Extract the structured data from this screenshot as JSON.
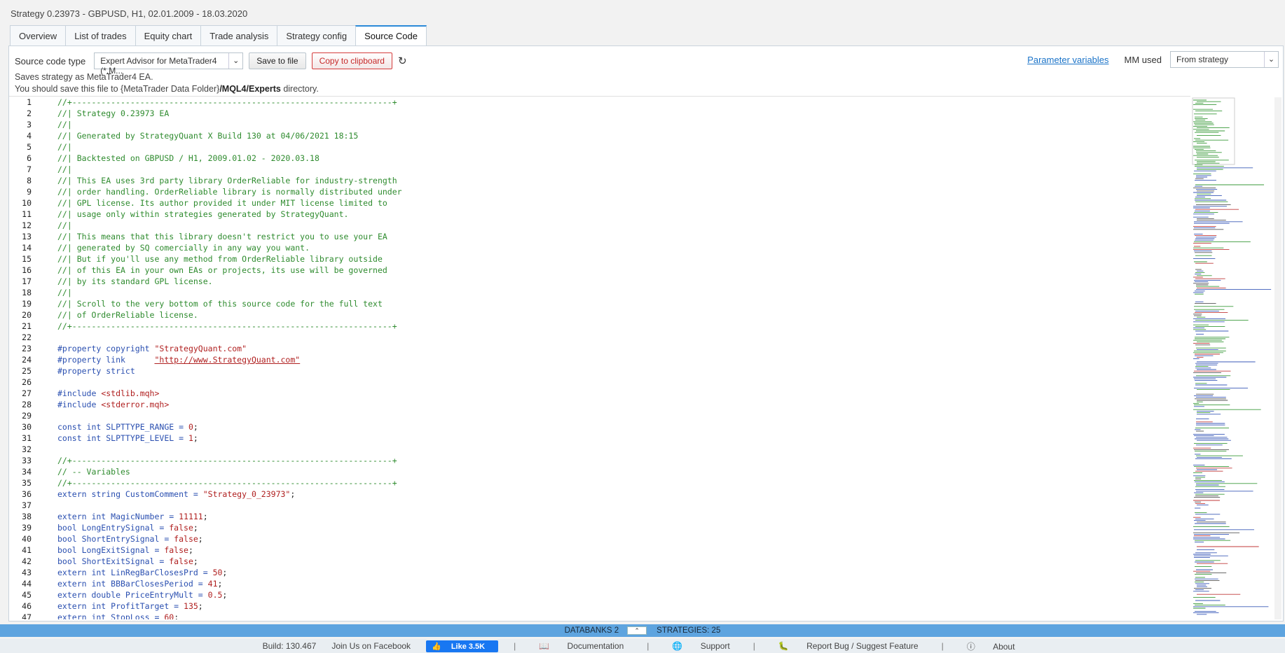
{
  "window_title": "Strategy 0.23973 - GBPUSD, H1, 02.01.2009 - 18.03.2020",
  "tabs": [
    {
      "label": "Overview"
    },
    {
      "label": "List of trades"
    },
    {
      "label": "Equity chart"
    },
    {
      "label": "Trade analysis"
    },
    {
      "label": "Strategy config"
    },
    {
      "label": "Source Code",
      "active": true
    }
  ],
  "toolbar": {
    "source_type_label": "Source code type",
    "source_type_value": "Expert Advisor for MetaTrader4 (*.M...",
    "save_label": "Save to file",
    "copy_label": "Copy to clipboard",
    "param_vars_label": "Parameter variables",
    "mm_used_label": "MM used",
    "mm_used_value": "From strategy"
  },
  "info": {
    "line1": "Saves strategy as MetaTrader4 EA.",
    "line2_pre": "You should save this file to {MetaTrader Data Folder}",
    "line2_bold": "/MQL4/Experts",
    "line2_post": " directory."
  },
  "code_lines": [
    {
      "n": "1",
      "t": "//+------------------------------------------------------------------+",
      "c": "c"
    },
    {
      "n": "2",
      "t": "//| Strategy 0.23973 EA",
      "c": "c"
    },
    {
      "n": "3",
      "t": "//|",
      "c": "c"
    },
    {
      "n": "4",
      "t": "//| Generated by StrategyQuant X Build 130 at 04/06/2021 18:15",
      "c": "c"
    },
    {
      "n": "5",
      "t": "//|",
      "c": "c"
    },
    {
      "n": "6",
      "t": "//| Backtested on GBPUSD / H1, 2009.01.02 - 2020.03.18",
      "c": "c"
    },
    {
      "n": "7",
      "t": "//|",
      "c": "c"
    },
    {
      "n": "8",
      "t": "//| This EA uses 3rd party library OrderReliable for industry-strength",
      "c": "c"
    },
    {
      "n": "9",
      "t": "//| order handling. OrderReliable library is normally distributed under",
      "c": "c"
    },
    {
      "n": "10",
      "t": "//| GPL license. Its author provided it under MIT license limited to",
      "c": "c"
    },
    {
      "n": "11",
      "t": "//| usage only within strategies generated by StrategyQuant.",
      "c": "c"
    },
    {
      "n": "12",
      "t": "//|",
      "c": "c"
    },
    {
      "n": "13",
      "t": "//| This means that this library doesn't restrict you to use your EA",
      "c": "c"
    },
    {
      "n": "14",
      "t": "//| generated by SQ comercially in any way you want.",
      "c": "c"
    },
    {
      "n": "15",
      "t": "//| But if you'll use any method from OrderReliable library outside",
      "c": "c"
    },
    {
      "n": "16",
      "t": "//| of this EA in your own EAs or projects, its use will be governed",
      "c": "c"
    },
    {
      "n": "17",
      "t": "//| by its standard GPL license.",
      "c": "c"
    },
    {
      "n": "18",
      "t": "//|",
      "c": "c"
    },
    {
      "n": "19",
      "t": "//| Scroll to the very bottom of this source code for the full text",
      "c": "c"
    },
    {
      "n": "20",
      "t": "//| of OrderReliable license.",
      "c": "c"
    },
    {
      "n": "21",
      "t": "//+------------------------------------------------------------------+",
      "c": "c"
    },
    {
      "n": "22",
      "t": "",
      "c": "d"
    },
    {
      "n": "23",
      "t": "#property copyright ",
      "c": "k",
      "s": "\"StrategyQuant.com\""
    },
    {
      "n": "24",
      "t": "#property link      ",
      "c": "k",
      "u": "\"http://www.StrategyQuant.com\""
    },
    {
      "n": "25",
      "t": "#property strict",
      "c": "k"
    },
    {
      "n": "26",
      "t": "",
      "c": "d"
    },
    {
      "n": "27",
      "t": "#include ",
      "c": "k",
      "s": "<stdlib.mqh>"
    },
    {
      "n": "28",
      "t": "#include ",
      "c": "k",
      "s": "<stderror.mqh>"
    },
    {
      "n": "29",
      "t": "",
      "c": "d"
    },
    {
      "n": "30",
      "t": "const int SLPTTYPE_RANGE = ",
      "c": "k",
      "s": "0",
      "e": ";"
    },
    {
      "n": "31",
      "t": "const int SLPTTYPE_LEVEL = ",
      "c": "k",
      "s": "1",
      "e": ";"
    },
    {
      "n": "32",
      "t": "",
      "c": "d"
    },
    {
      "n": "33",
      "t": "//+------------------------------------------------------------------+",
      "c": "c"
    },
    {
      "n": "34",
      "t": "// -- Variables",
      "c": "c"
    },
    {
      "n": "35",
      "t": "//+------------------------------------------------------------------+",
      "c": "c"
    },
    {
      "n": "36",
      "t": "extern string CustomComment = ",
      "c": "k",
      "s": "\"Strategy_0_23973\"",
      "e": ";"
    },
    {
      "n": "37",
      "t": "",
      "c": "d"
    },
    {
      "n": "38",
      "t": "extern int MagicNumber = ",
      "c": "k",
      "s": "11111",
      "e": ";"
    },
    {
      "n": "39",
      "t": "bool LongEntrySignal = ",
      "c": "k",
      "s": "false",
      "e": ";"
    },
    {
      "n": "40",
      "t": "bool ShortEntrySignal = ",
      "c": "k",
      "s": "false",
      "e": ";"
    },
    {
      "n": "41",
      "t": "bool LongExitSignal = ",
      "c": "k",
      "s": "false",
      "e": ";"
    },
    {
      "n": "42",
      "t": "bool ShortExitSignal = ",
      "c": "k",
      "s": "false",
      "e": ";"
    },
    {
      "n": "43",
      "t": "extern int LinRegBarClosesPrd = ",
      "c": "k",
      "s": "50",
      "e": ";"
    },
    {
      "n": "44",
      "t": "extern int BBBarClosesPeriod = ",
      "c": "k",
      "s": "41",
      "e": ";"
    },
    {
      "n": "45",
      "t": "extern double PriceEntryMult = ",
      "c": "k",
      "s": "0.5",
      "e": ";"
    },
    {
      "n": "46",
      "t": "extern int ProfitTarget = ",
      "c": "k",
      "s": "135",
      "e": ";"
    },
    {
      "n": "47",
      "t": "extern int StopLoss = ",
      "c": "k",
      "s": "60",
      "e": ";"
    }
  ],
  "status": {
    "databanks": "DATABANKS 2",
    "strategies": "STRATEGIES: 25"
  },
  "footer": {
    "build": "Build: 130.467",
    "facebook": "Join Us on Facebook",
    "like": "Like 3.5K",
    "documentation": "Documentation",
    "support": "Support",
    "report": "Report Bug / Suggest Feature",
    "about": "About"
  }
}
